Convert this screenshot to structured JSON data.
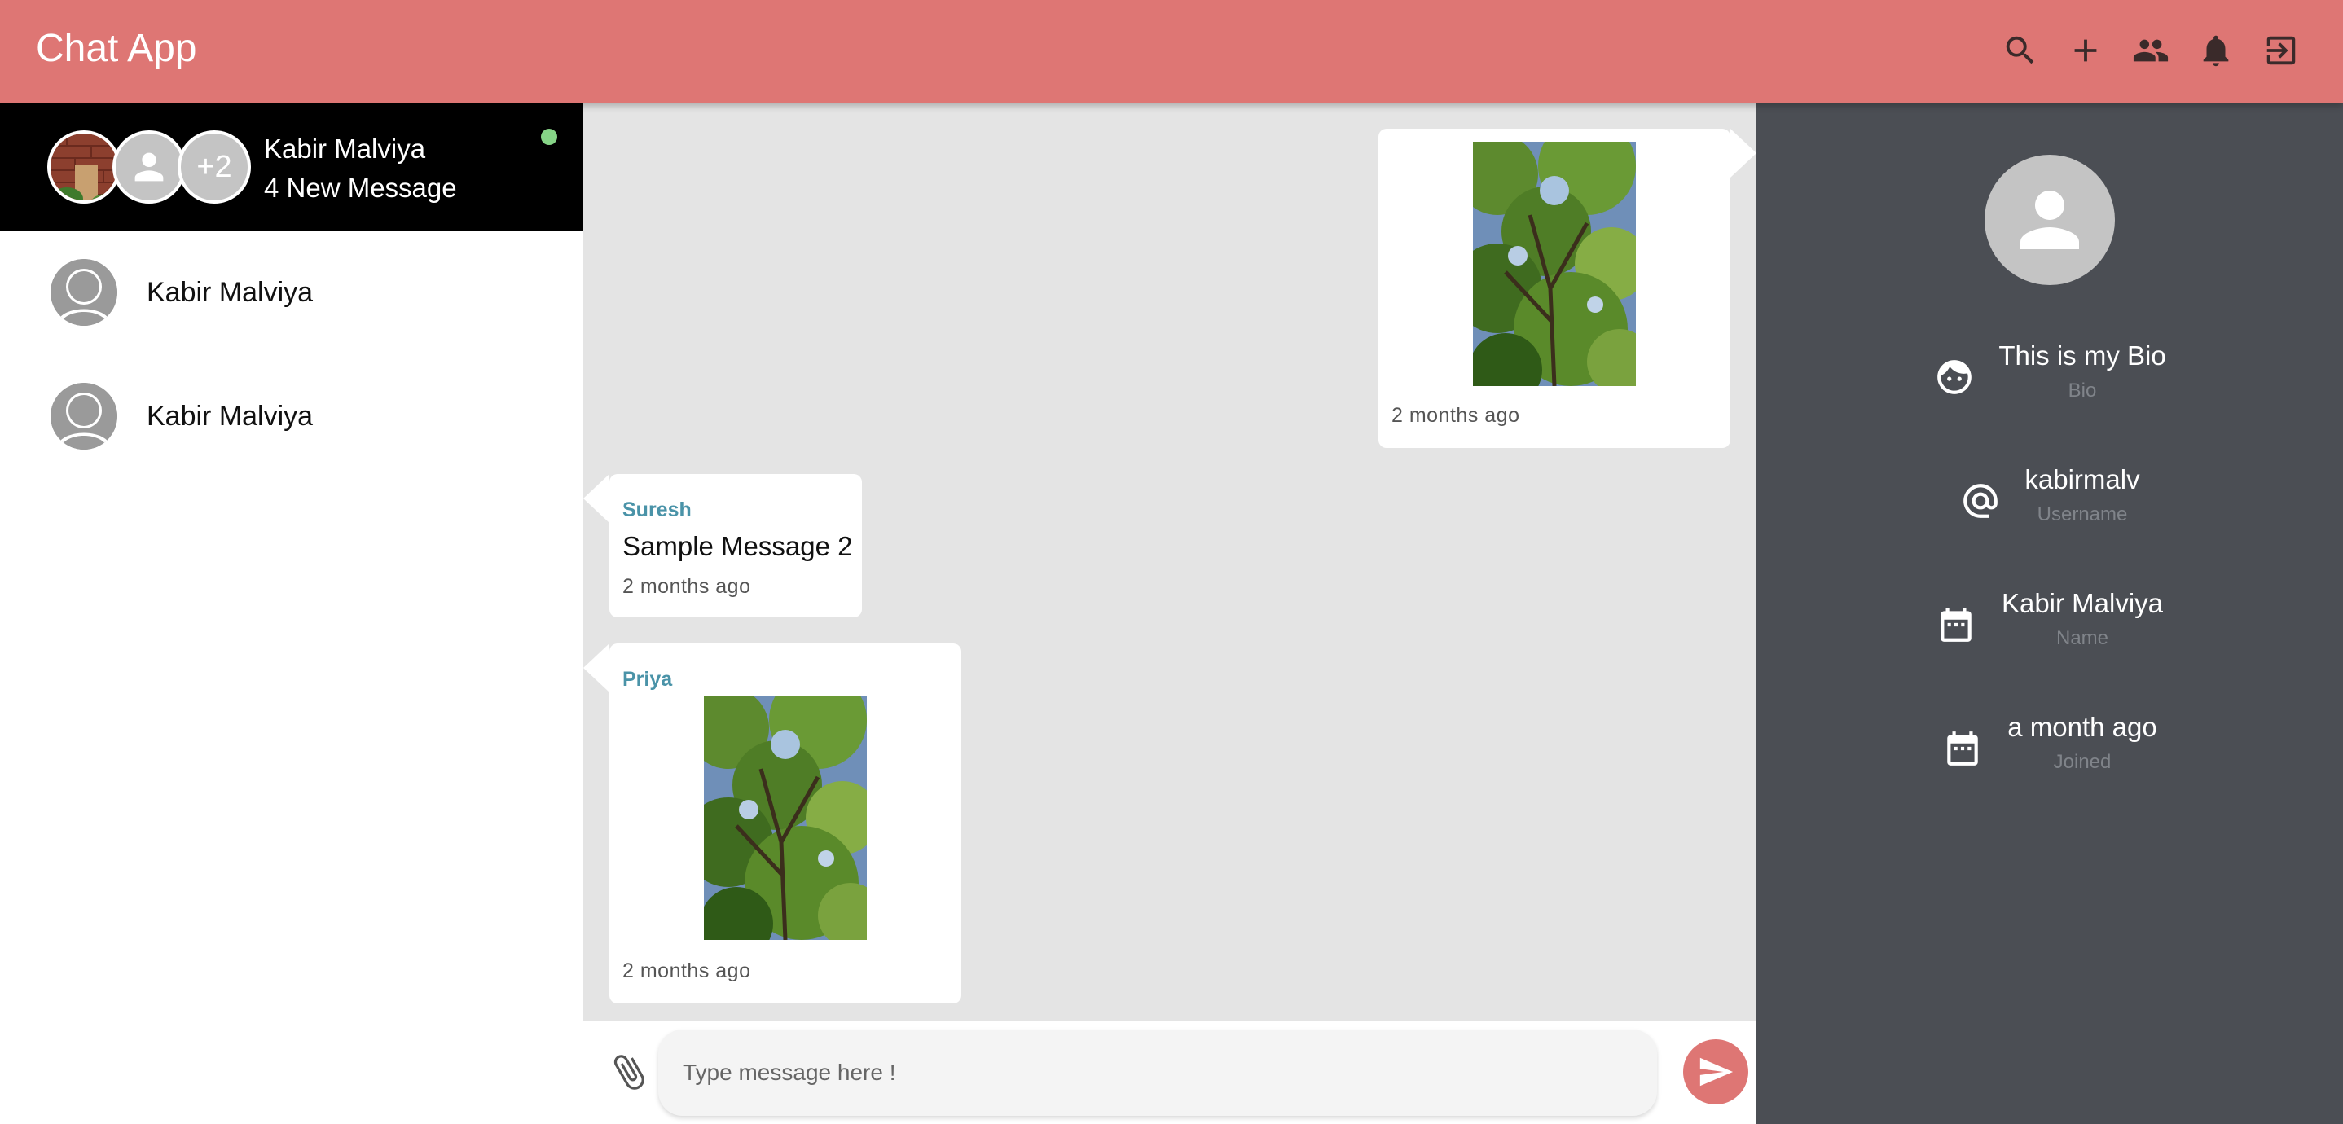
{
  "app": {
    "title": "Chat App"
  },
  "header_icons": [
    "search-icon",
    "add-icon",
    "group-icon",
    "bell-icon",
    "logout-icon"
  ],
  "sidebar": {
    "active_group": {
      "name": "Kabir Malviya",
      "subtitle": "4 New Message",
      "extra_count": "+2",
      "online": true
    },
    "contacts": [
      {
        "name": "Kabir Malviya"
      },
      {
        "name": "Kabir Malviya"
      }
    ]
  },
  "messages": [
    {
      "type": "image",
      "outgoing": true,
      "time": "2 months ago"
    },
    {
      "type": "text",
      "outgoing": false,
      "sender": "Suresh",
      "text": "Sample Message 2",
      "time": "2 months ago"
    },
    {
      "type": "image",
      "outgoing": false,
      "sender": "Priya",
      "time": "2 months ago"
    }
  ],
  "composer": {
    "placeholder": "Type message here !"
  },
  "profile": {
    "bio": {
      "value": "This is my Bio",
      "label": "Bio"
    },
    "username": {
      "value": "kabirmalv",
      "label": "Username"
    },
    "name": {
      "value": "Kabir Malviya",
      "label": "Name"
    },
    "joined": {
      "value": "a month ago",
      "label": "Joined"
    }
  },
  "colors": {
    "accent": "#de7674",
    "online": "#86d487",
    "sender_name": "#4a93a8",
    "profile_bg": "#4b4e54"
  }
}
